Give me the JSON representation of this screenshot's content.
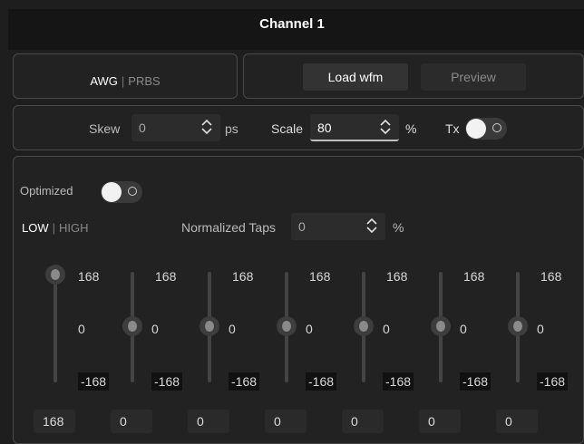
{
  "header": {
    "title": "Channel 1"
  },
  "mode": {
    "awg_label": "AWG",
    "separator": "|",
    "prbs_label": "PRBS"
  },
  "waveform": {
    "load_label": "Load wfm",
    "preview_label": "Preview"
  },
  "settings": {
    "skew_label": "Skew",
    "skew_value": "0",
    "skew_unit": "ps",
    "scale_label": "Scale",
    "scale_value": "80",
    "scale_unit": "%",
    "tx_label": "Tx",
    "tx_on": false
  },
  "taps": {
    "optimized_label": "Optimized",
    "optimized_on": false,
    "low_label": "LOW",
    "separator": "|",
    "high_label": "HIGH",
    "normalized_label": "Normalized Taps",
    "normalized_value": "0",
    "normalized_unit": "%",
    "slider_max_label": "168",
    "slider_mid_label": "0",
    "slider_min_label": "-168",
    "sliders": [
      {
        "value": 168,
        "input_value": "168"
      },
      {
        "value": 0,
        "input_value": "0"
      },
      {
        "value": 0,
        "input_value": "0"
      },
      {
        "value": 0,
        "input_value": "0"
      },
      {
        "value": 0,
        "input_value": "0"
      },
      {
        "value": 0,
        "input_value": "0"
      },
      {
        "value": 0,
        "input_value": "0"
      }
    ]
  },
  "colors": {
    "background": "#1e1e1e",
    "panel": "#222222",
    "border": "#4a4a4a",
    "accent": "#ffffff"
  }
}
